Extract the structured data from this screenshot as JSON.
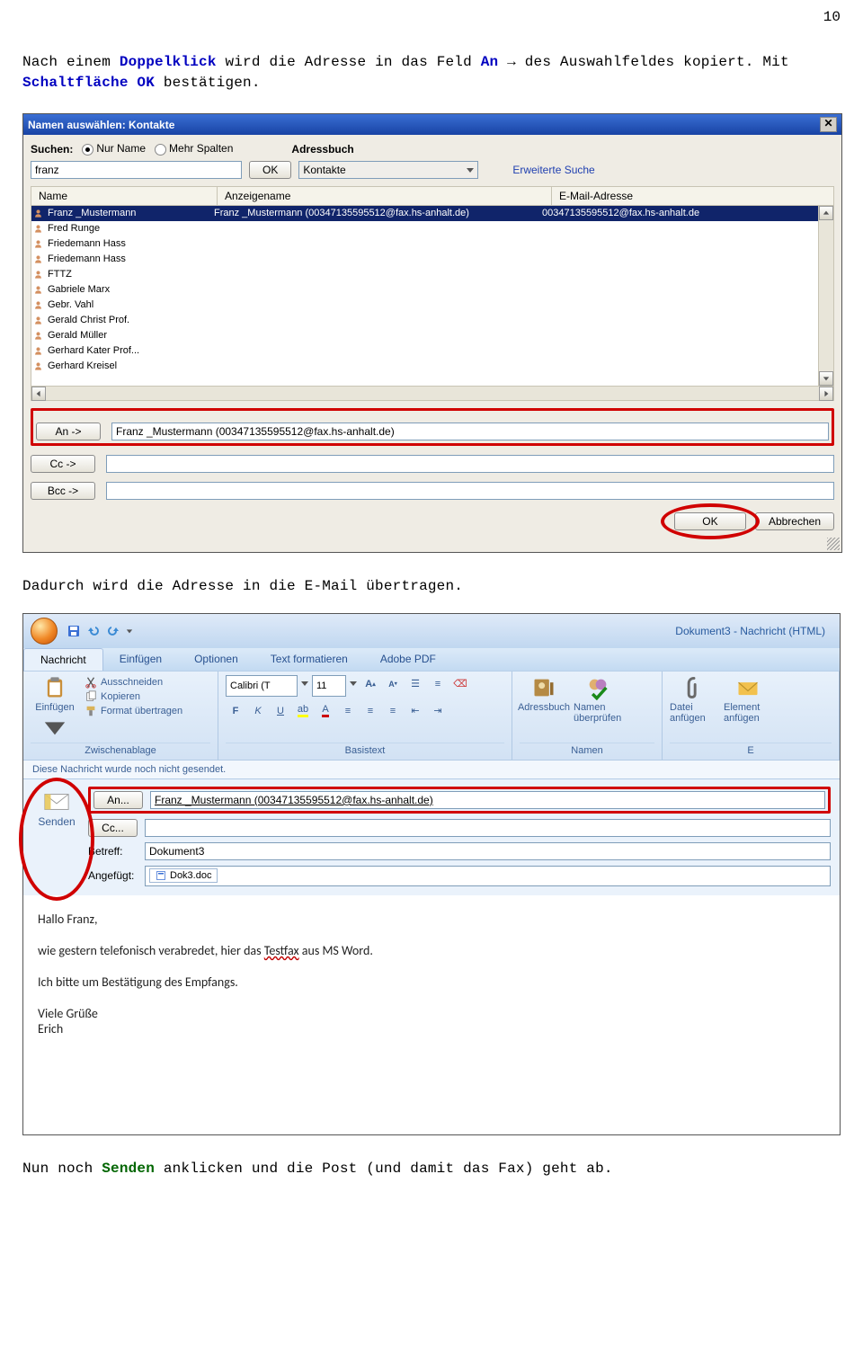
{
  "doc": {
    "page_no": "10",
    "p1_a": "Nach einem ",
    "p1_b": "Doppelklick",
    "p1_c": " wird die Adresse in das Feld ",
    "p1_d": "An",
    "p1_e": " → des Auswahlfeldes kopiert. Mit ",
    "p1_f": "Schaltfläche OK",
    "p1_g": " bestätigen.",
    "p2": "Dadurch wird die Adresse in die E-Mail übertragen.",
    "p3_a": "Nun noch ",
    "p3_b": "Senden",
    "p3_c": " anklicken und die Post (und damit das Fax) geht ab."
  },
  "dlg1": {
    "title": "Namen auswählen: Kontakte",
    "suchen": "Suchen:",
    "nur_name": "Nur Name",
    "mehr_spalten": "Mehr Spalten",
    "adressbuch": "Adressbuch",
    "search_value": "franz",
    "ok_small": "OK",
    "combo": "Kontakte",
    "erweiterte": "Erweiterte Suche",
    "col_name": "Name",
    "col_anzeigename": "Anzeigename",
    "col_email": "E-Mail-Adresse",
    "contacts": [
      {
        "n": "Franz _Mustermann",
        "d": "Franz _Mustermann (00347135595512@fax.hs-anhalt.de)",
        "e": "00347135595512@fax.hs-anhalt.de",
        "sel": true
      },
      {
        "n": "Fred Runge"
      },
      {
        "n": "Friedemann Hass"
      },
      {
        "n": "Friedemann Hass"
      },
      {
        "n": "FTTZ"
      },
      {
        "n": "Gabriele Marx"
      },
      {
        "n": "Gebr. Vahl"
      },
      {
        "n": "Gerald Christ Prof."
      },
      {
        "n": "Gerald Müller"
      },
      {
        "n": "Gerhard Kater Prof..."
      },
      {
        "n": "Gerhard Kreisel"
      }
    ],
    "an": "An ->",
    "cc": "Cc ->",
    "bcc": "Bcc ->",
    "an_value": "Franz _Mustermann (00347135595512@fax.hs-anhalt.de)",
    "ok": "OK",
    "abbrechen": "Abbrechen"
  },
  "dlg2": {
    "titlebar": "Dokument3 - Nachricht (HTML)",
    "tabs": [
      "Nachricht",
      "Einfügen",
      "Optionen",
      "Text formatieren",
      "Adobe PDF"
    ],
    "paste": "Einfügen",
    "cut": "Ausschneiden",
    "copy": "Kopieren",
    "format_painter": "Format übertragen",
    "grp_clip": "Zwischenablage",
    "font": "Calibri (T",
    "size": "11",
    "grp_basis": "Basistext",
    "adressbuch": "Adressbuch",
    "namen_pruefen": "Namen überprüfen",
    "grp_namen": "Namen",
    "datei": "Datei anfügen",
    "element": "Element anfügen",
    "grp_e": "E",
    "infobar": "Diese Nachricht wurde noch nicht gesendet.",
    "senden": "Senden",
    "an": "An...",
    "cc": "Cc...",
    "betreff": "Betreff:",
    "angefuegt": "Angefügt:",
    "an_value": "Franz _Mustermann (00347135595512@fax.hs-anhalt.de)",
    "betreff_value": "Dokument3",
    "attach": "Dok3.doc",
    "body": {
      "l1": "Hallo Franz,",
      "l2a": "wie gestern telefonisch verabredet, hier das ",
      "l2b": "Testfax",
      "l2c": " aus MS Word.",
      "l3": "Ich bitte um Bestätigung des Empfangs.",
      "l4": "Viele Grüße",
      "l5": "Erich"
    }
  }
}
